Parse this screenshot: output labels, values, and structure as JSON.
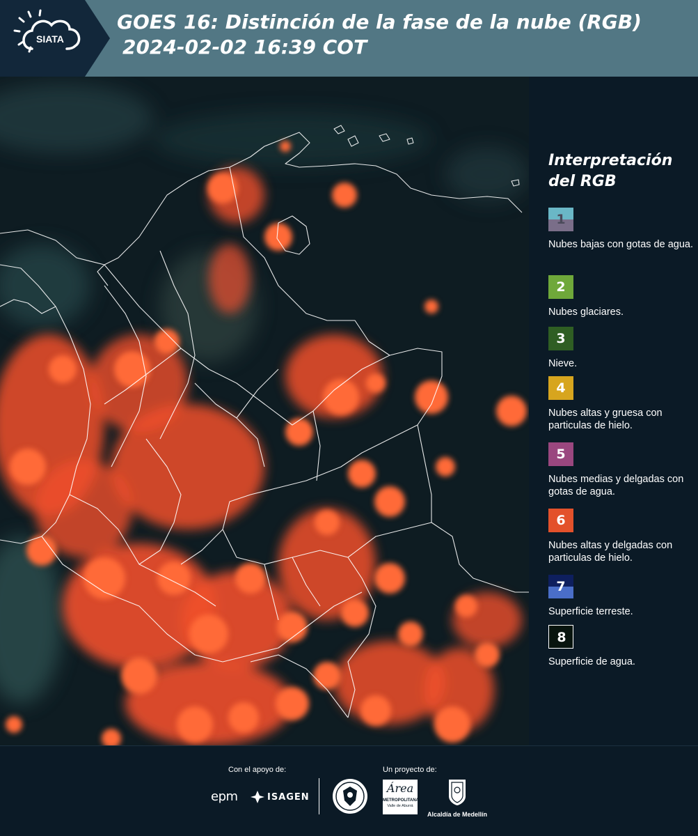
{
  "header": {
    "logo_text": "SIATA",
    "title_line1": "GOES 16: Distinción de la fase de la nube (RGB)",
    "title_line2": "2024-02-02 16:39 COT"
  },
  "map": {
    "description_colors": {
      "background_dark": "#0d1d24",
      "cloud_orange": "#ff5a2a",
      "border_white": "#ffffff"
    }
  },
  "legend": {
    "title": "Interpretación del RGB",
    "items": [
      {
        "number": "1",
        "label": "Nubes bajas con gotas de agua.",
        "color_top": "#6ab7c6",
        "color_bottom": "#7a6e89",
        "text_color": "#4a4a5a"
      },
      {
        "number": "2",
        "label": "Nubes glaciares.",
        "color_top": "#6fa83a",
        "color_bottom": "#6fa83a",
        "text_color": "#ffffff"
      },
      {
        "number": "3",
        "label": "Nieve.",
        "color_top": "#2f5e23",
        "color_bottom": "#2f5e23",
        "text_color": "#ffffff"
      },
      {
        "number": "4",
        "label": "Nubes altas y gruesa con particulas de hielo.",
        "color_top": "#d7a51e",
        "color_bottom": "#d7a51e",
        "text_color": "#ffffff"
      },
      {
        "number": "5",
        "label": "Nubes medias y delgadas con gotas de agua.",
        "color_top": "#9a477f",
        "color_bottom": "#9a477f",
        "text_color": "#ffffff"
      },
      {
        "number": "6",
        "label": "Nubes altas y delgadas con particulas de hielo.",
        "color_top": "#e3512b",
        "color_bottom": "#e3512b",
        "text_color": "#ffffff"
      },
      {
        "number": "7",
        "label": "Superficie terreste.",
        "color_top": "#0e1f5e",
        "color_bottom": "#4a6ec8",
        "text_color": "#ffffff"
      },
      {
        "number": "8",
        "label": "Superficie de agua.",
        "color_top": "#08140e",
        "color_bottom": "#08140e",
        "text_color": "#ffffff"
      }
    ]
  },
  "footer": {
    "support_label": "Con el apoyo de:",
    "project_label": "Un proyecto de:",
    "partners": {
      "epm": "epm",
      "isagen": "ISAGEN",
      "area_metro_line1": "Área",
      "area_metro_line2": "METROPOLITANA",
      "area_metro_line3": "Valle de Aburrá",
      "alcaldia": "Alcaldía de Medellín"
    }
  }
}
